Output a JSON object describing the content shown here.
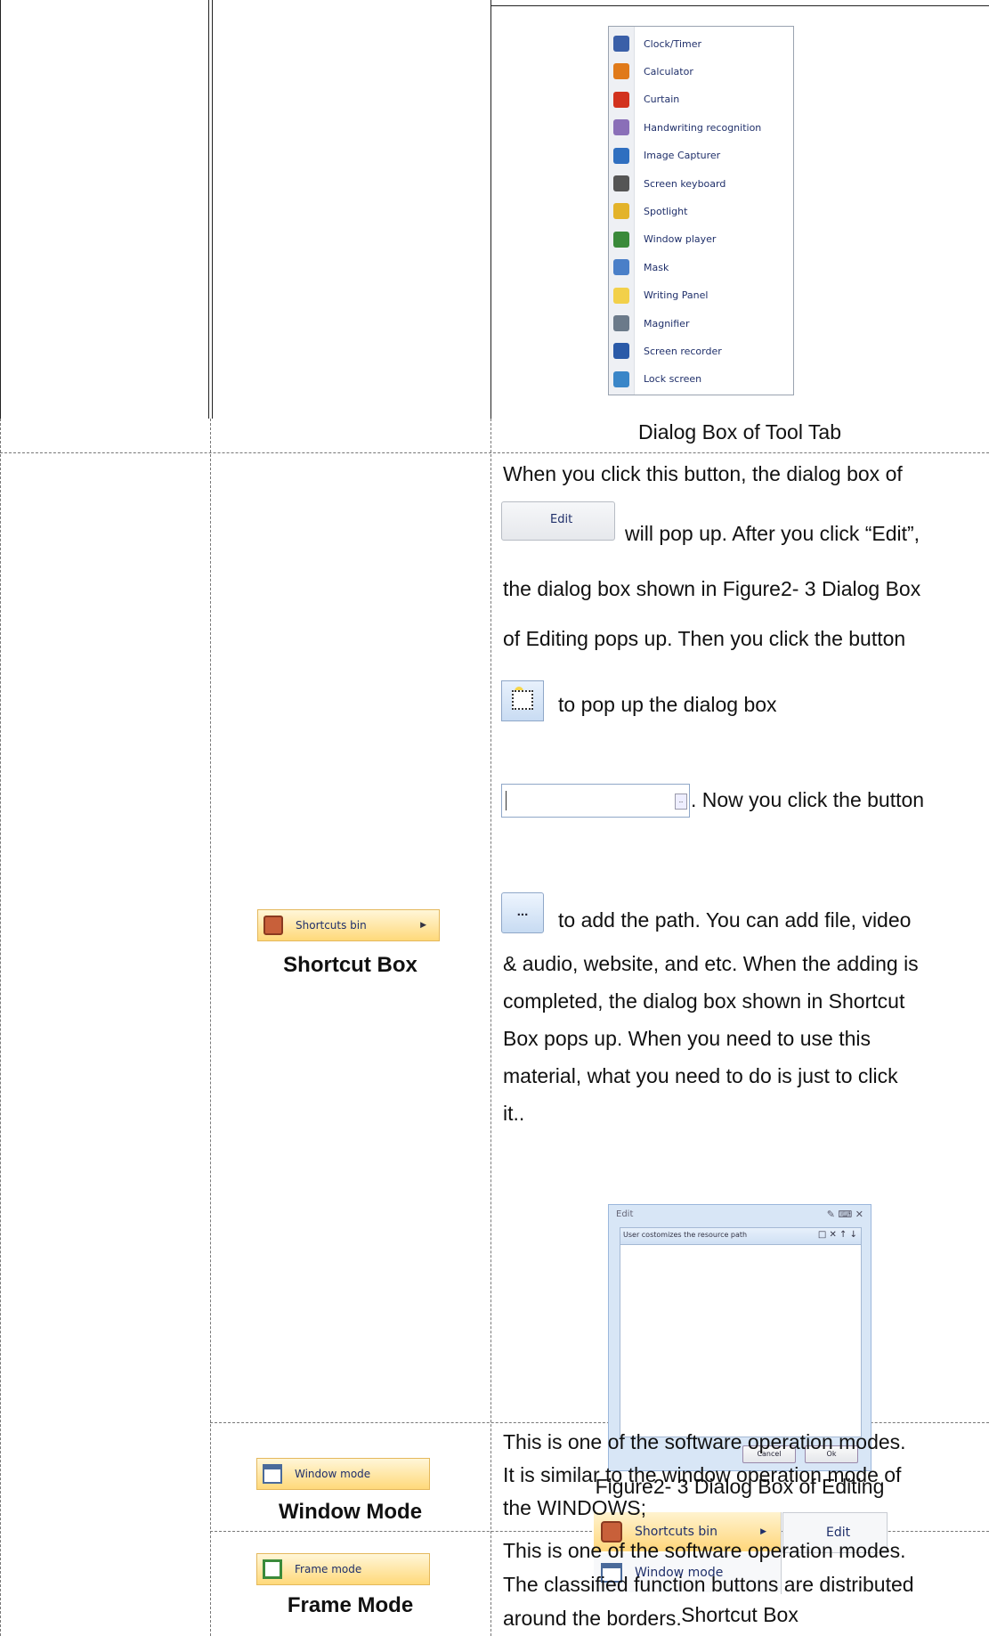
{
  "tool_menu": {
    "items": [
      {
        "label": "Clock/Timer",
        "icon": "clock-icon",
        "color": "#3a5fa8"
      },
      {
        "label": "Calculator",
        "icon": "calculator-icon",
        "color": "#e07a1a"
      },
      {
        "label": "Curtain",
        "icon": "curtain-icon",
        "color": "#d2321e"
      },
      {
        "label": "Handwriting recognition",
        "icon": "handwriting-icon",
        "color": "#8a6fb8"
      },
      {
        "label": "Image Capturer",
        "icon": "image-capturer-icon",
        "color": "#2f6fc0"
      },
      {
        "label": "Screen keyboard",
        "icon": "keyboard-icon",
        "color": "#555555"
      },
      {
        "label": "Spotlight",
        "icon": "spotlight-icon",
        "color": "#e3b32a"
      },
      {
        "label": "Window player",
        "icon": "window-player-icon",
        "color": "#3a8a3a"
      },
      {
        "label": "Mask",
        "icon": "mask-icon",
        "color": "#4a7fc8"
      },
      {
        "label": "Writing Panel",
        "icon": "writing-panel-icon",
        "color": "#f2d04a"
      },
      {
        "label": "Magnifier",
        "icon": "magnifier-icon",
        "color": "#6b7a8a"
      },
      {
        "label": "Screen recorder",
        "icon": "screen-recorder-icon",
        "color": "#2a5aa8"
      },
      {
        "label": "Lock screen",
        "icon": "lock-screen-icon",
        "color": "#3a86c8"
      }
    ],
    "caption": "Dialog Box of Tool Tab"
  },
  "shortcut_row": {
    "button_label": "Shortcuts bin",
    "title": "Shortcut Box",
    "para": {
      "t1": "When you click this button, the dialog box of",
      "edit_btn": "Edit",
      "t2": "will pop up. After you click “Edit”,",
      "t3": "the dialog box shown in Figure2- 3 Dialog Box",
      "t4": "of Editing    pops up. Then you click the button",
      "t5": "to pop up the dialog box",
      "t6": ". Now you click the button",
      "t7": "to add the path. You can add file, video",
      "t8": "& audio, website, and etc. When the adding is",
      "t9": "completed, the dialog box shown in Shortcut",
      "t10": "Box pops up. When you need to use this",
      "t11": "material, what you need to do is just to click",
      "t12": "it.."
    },
    "dots_label": "...",
    "edit_dialog": {
      "title": "Edit",
      "header_text": "User costomizes the resource path",
      "cancel": "Cancel",
      "ok": "Ok"
    },
    "figure_caption": "Figure2- 3 Dialog Box of Editing",
    "menu": {
      "shortcuts_bin": "Shortcuts bin",
      "window_mode": "Window mode",
      "edit": "Edit"
    },
    "menu_caption": "Shortcut Box"
  },
  "window_row": {
    "button_label": "Window mode",
    "title": "Window Mode",
    "l1": "This is one of the software operation modes.",
    "l2": "It is similar to the window operation mode of",
    "l3": "the WINDOWS;"
  },
  "frame_row": {
    "button_label": "Frame mode",
    "title": "Frame Mode",
    "l1": "This is one of the software operation modes.",
    "l2": "The classified function buttons are distributed",
    "l3": "around the borders."
  }
}
